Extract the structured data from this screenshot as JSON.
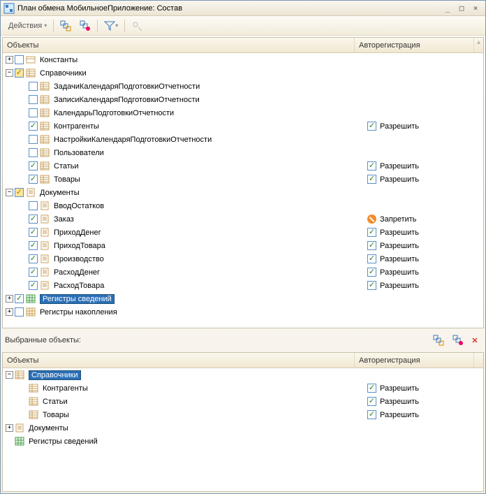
{
  "window": {
    "title": "План обмена МобильноеПриложение: Состав"
  },
  "toolbar": {
    "actions_label": "Действия"
  },
  "top_grid": {
    "headers": {
      "objects": "Объекты",
      "auto": "Авторегистрация"
    },
    "rows": [
      {
        "level": 0,
        "expander": "plus",
        "check": "off",
        "icon": "const",
        "label": "Константы",
        "auto": null
      },
      {
        "level": 0,
        "expander": "minus",
        "check": "partial",
        "icon": "cat",
        "label": "Справочники",
        "auto": null
      },
      {
        "level": 1,
        "expander": "none",
        "check": "off",
        "icon": "cat",
        "label": "ЗадачиКалендаряПодготовкиОтчетности",
        "auto": null
      },
      {
        "level": 1,
        "expander": "none",
        "check": "off",
        "icon": "cat",
        "label": "ЗаписиКалендаряПодготовкиОтчетности",
        "auto": null
      },
      {
        "level": 1,
        "expander": "none",
        "check": "off",
        "icon": "cat",
        "label": "КалендарьПодготовкиОтчетности",
        "auto": null
      },
      {
        "level": 1,
        "expander": "none",
        "check": "on",
        "icon": "cat",
        "label": "Контрагенты",
        "auto": {
          "kind": "allow",
          "label": "Разрешить"
        }
      },
      {
        "level": 1,
        "expander": "none",
        "check": "off",
        "icon": "cat",
        "label": "НастройкиКалендаряПодготовкиОтчетности",
        "auto": null
      },
      {
        "level": 1,
        "expander": "none",
        "check": "off",
        "icon": "cat",
        "label": "Пользователи",
        "auto": null
      },
      {
        "level": 1,
        "expander": "none",
        "check": "on",
        "icon": "cat",
        "label": "Статьи",
        "auto": {
          "kind": "allow",
          "label": "Разрешить"
        }
      },
      {
        "level": 1,
        "expander": "none",
        "check": "on",
        "icon": "cat",
        "label": "Товары",
        "auto": {
          "kind": "allow",
          "label": "Разрешить"
        }
      },
      {
        "level": 0,
        "expander": "minus",
        "check": "partial",
        "icon": "doc",
        "label": "Документы",
        "auto": null
      },
      {
        "level": 1,
        "expander": "none",
        "check": "off",
        "icon": "doc",
        "label": "ВводОстатков",
        "auto": null
      },
      {
        "level": 1,
        "expander": "none",
        "check": "on",
        "icon": "doc",
        "label": "Заказ",
        "auto": {
          "kind": "deny",
          "label": "Запретить"
        }
      },
      {
        "level": 1,
        "expander": "none",
        "check": "on",
        "icon": "doc",
        "label": "ПриходДенег",
        "auto": {
          "kind": "allow",
          "label": "Разрешить"
        }
      },
      {
        "level": 1,
        "expander": "none",
        "check": "on",
        "icon": "doc",
        "label": "ПриходТовара",
        "auto": {
          "kind": "allow",
          "label": "Разрешить"
        }
      },
      {
        "level": 1,
        "expander": "none",
        "check": "on",
        "icon": "doc",
        "label": "Производство",
        "auto": {
          "kind": "allow",
          "label": "Разрешить"
        }
      },
      {
        "level": 1,
        "expander": "none",
        "check": "on",
        "icon": "doc",
        "label": "РасходДенег",
        "auto": {
          "kind": "allow",
          "label": "Разрешить"
        }
      },
      {
        "level": 1,
        "expander": "none",
        "check": "on",
        "icon": "doc",
        "label": "РасходТовара",
        "auto": {
          "kind": "allow",
          "label": "Разрешить"
        }
      },
      {
        "level": 0,
        "expander": "plus",
        "check": "on",
        "icon": "reg",
        "label": "Регистры сведений",
        "auto": null,
        "selected": true
      },
      {
        "level": 0,
        "expander": "plus",
        "check": "off",
        "icon": "reg2",
        "label": "Регистры накопления",
        "auto": null
      }
    ]
  },
  "selected_panel": {
    "title": "Выбранные объекты:",
    "headers": {
      "objects": "Объекты",
      "auto": "Авторегистрация"
    },
    "rows": [
      {
        "level": 0,
        "expander": "minus",
        "icon": "cat",
        "label": "Справочники",
        "auto": null,
        "selected": true
      },
      {
        "level": 1,
        "expander": "none",
        "icon": "cat",
        "label": "Контрагенты",
        "auto": {
          "kind": "allow",
          "label": "Разрешить"
        }
      },
      {
        "level": 1,
        "expander": "none",
        "icon": "cat",
        "label": "Статьи",
        "auto": {
          "kind": "allow",
          "label": "Разрешить"
        }
      },
      {
        "level": 1,
        "expander": "none",
        "icon": "cat",
        "label": "Товары",
        "auto": {
          "kind": "allow",
          "label": "Разрешить"
        }
      },
      {
        "level": 0,
        "expander": "plus",
        "icon": "doc",
        "label": "Документы",
        "auto": null
      },
      {
        "level": 0,
        "expander": "none",
        "icon": "reg",
        "label": "Регистры сведений",
        "auto": null
      }
    ]
  }
}
